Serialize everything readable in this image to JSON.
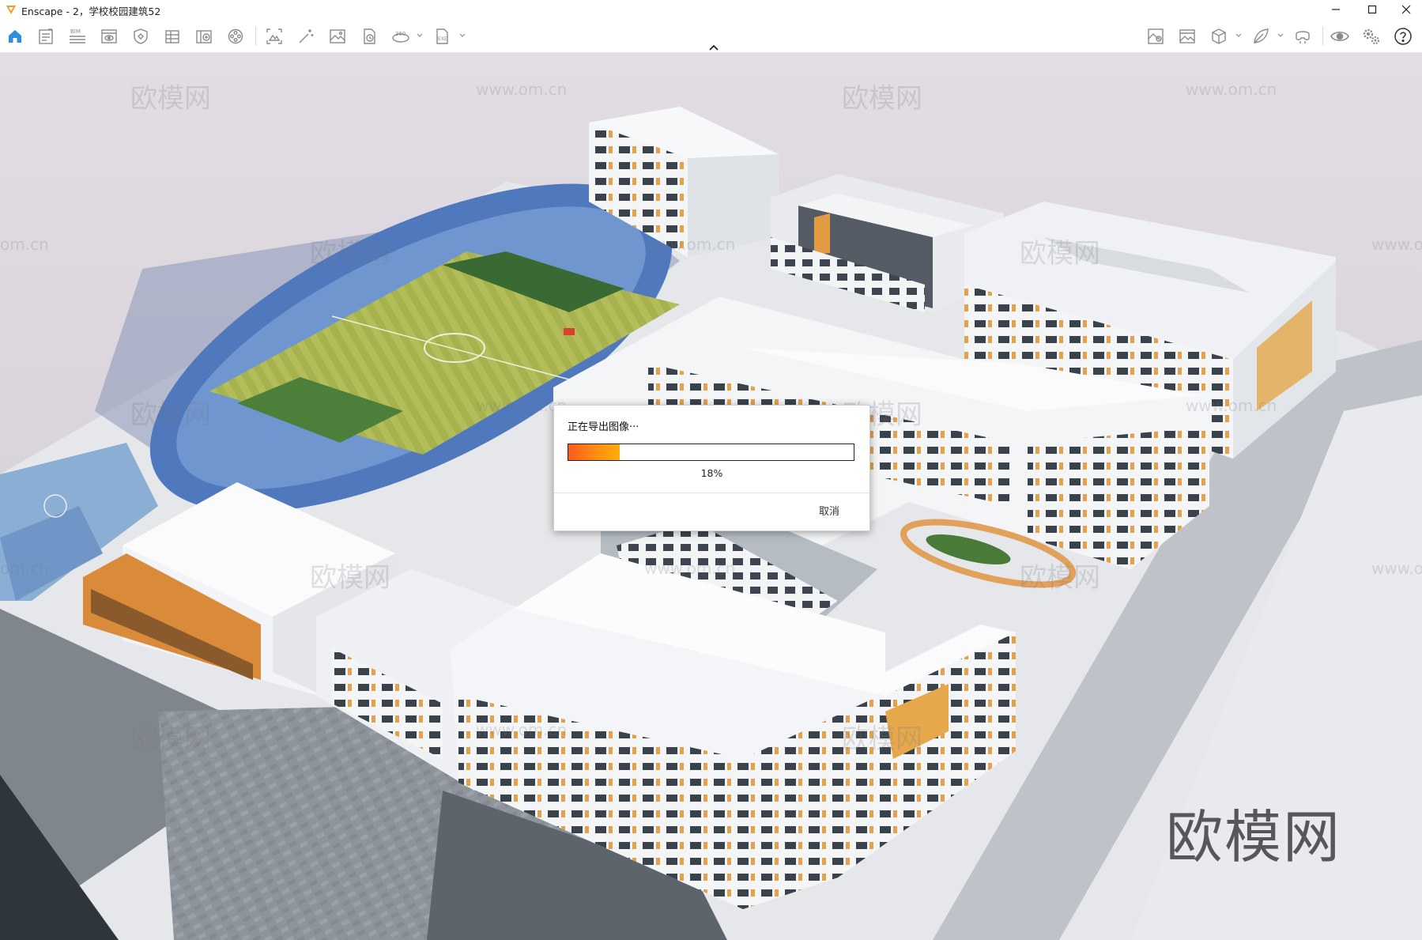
{
  "window": {
    "title": "Enscape - 2，学校校园建筑52"
  },
  "toolbar": {
    "left_tools": [
      {
        "icon": "home-icon",
        "active": true
      },
      {
        "icon": "document-icon"
      },
      {
        "icon": "bim-icon",
        "label": "BIM"
      },
      {
        "icon": "view-icon"
      },
      {
        "icon": "sync-shield-icon"
      },
      {
        "icon": "grid-icon"
      },
      {
        "icon": "asset-library-icon"
      },
      {
        "icon": "film-reel-icon"
      },
      {
        "icon": "screenshot-icon"
      },
      {
        "icon": "magic-wand-icon"
      },
      {
        "icon": "image-icon"
      },
      {
        "icon": "batch-render-icon"
      },
      {
        "icon": "panorama-360-icon",
        "label": "360"
      },
      {
        "icon": "export-exe-icon",
        "label": "EXE"
      }
    ],
    "right_tools": [
      {
        "icon": "map-export-icon"
      },
      {
        "icon": "image-gallery-icon"
      },
      {
        "icon": "cube-icon"
      },
      {
        "icon": "leaf-icon"
      },
      {
        "icon": "vr-headset-icon"
      },
      {
        "icon": "eye-icon"
      },
      {
        "icon": "settings-gears-icon"
      },
      {
        "icon": "help-icon"
      }
    ]
  },
  "viewport": {
    "watermark_small": "欧模网",
    "watermark_url": "www.om.cn",
    "watermark_url_partial": "om.cn",
    "watermark_url_partial_right": "www.o",
    "watermark_big": "欧模网"
  },
  "export_dialog": {
    "title": "正在导出图像···",
    "progress_fraction": 0.18,
    "progress_label": "18%",
    "cancel_label": "取消"
  },
  "colors": {
    "progress_start": "#ff5a1e",
    "progress_end": "#ffae0a",
    "home_icon": "#2d8fdd",
    "logo": "#f39a1e"
  }
}
